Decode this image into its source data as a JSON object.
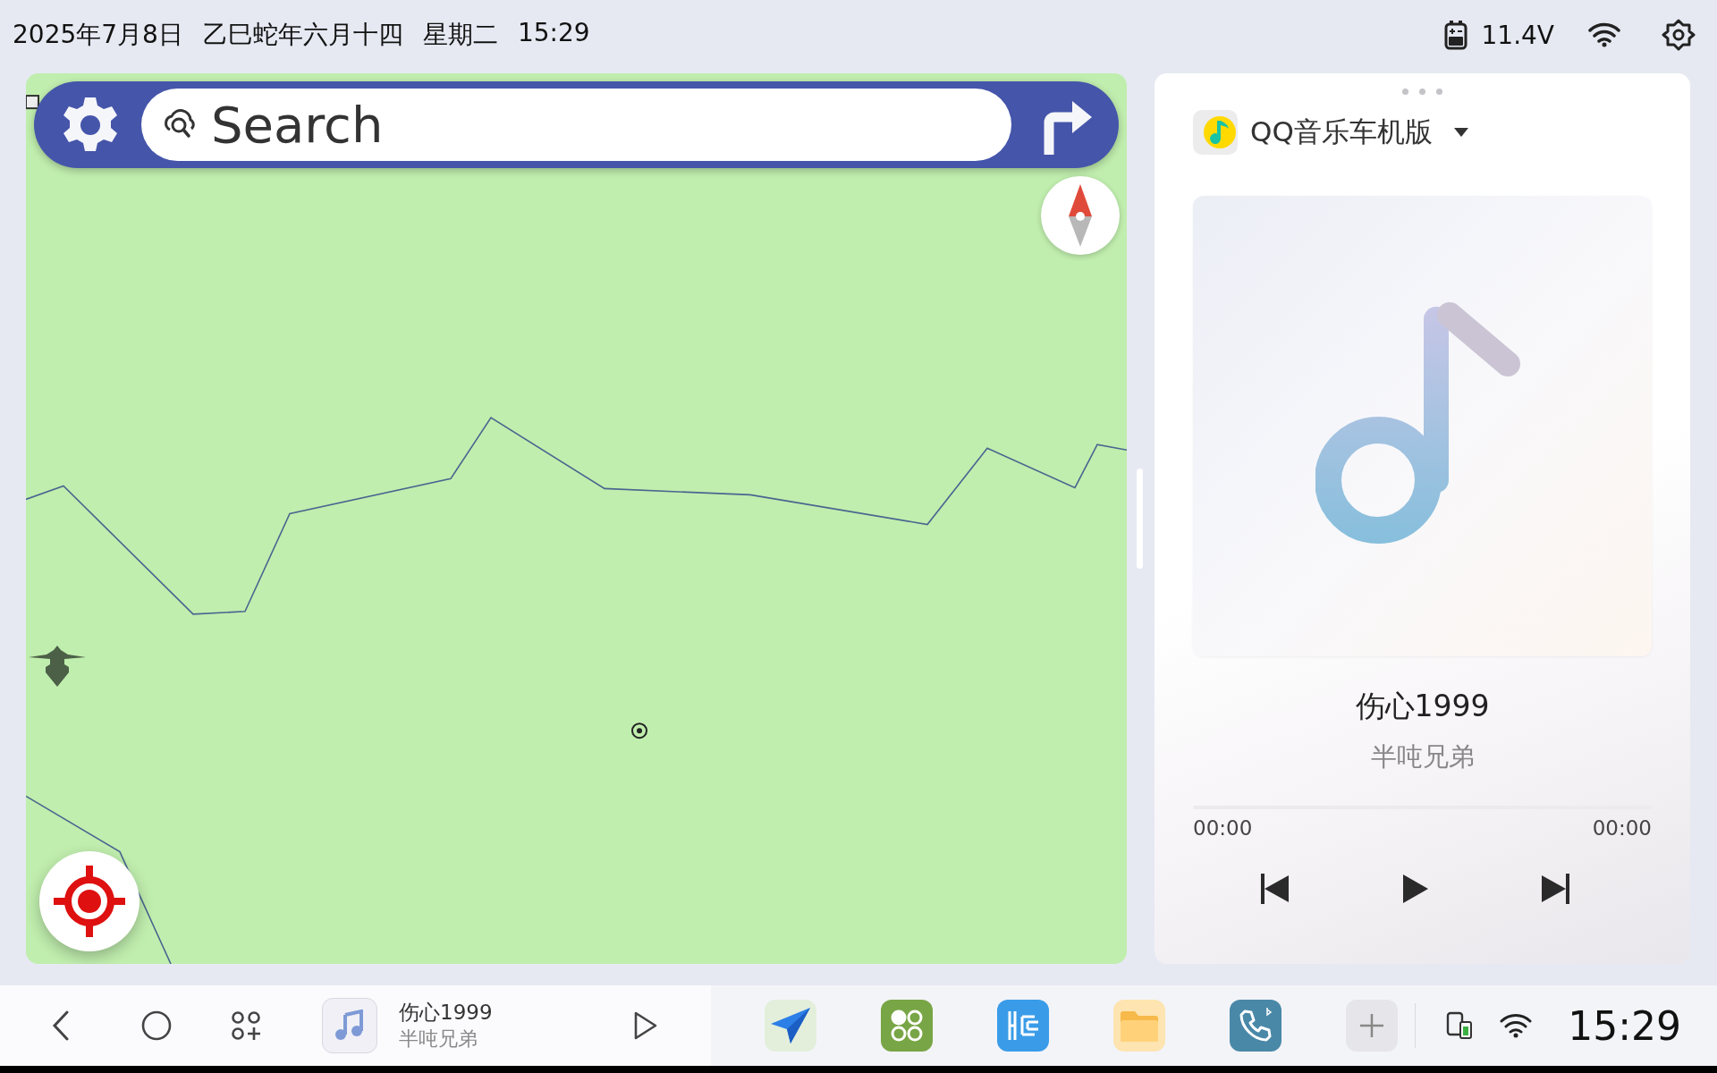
{
  "status_bar": {
    "date": "2025年7月8日",
    "lunar": "乙巳蛇年六月十四",
    "weekday": "星期二",
    "time": "15:29",
    "voltage": "11.4V"
  },
  "map": {
    "kind": "picture",
    "search": {
      "placeholder": "Search"
    }
  },
  "music": {
    "app_name": "QQ音乐车机版",
    "title": "伤心1999",
    "artist": "半吨兄弟",
    "elapsed": "00:00",
    "duration": "00:00",
    "progress": {
      "level": 0
    }
  },
  "taskbar": {
    "now_playing": {
      "title": "伤心1999",
      "artist": "半吨兄弟"
    },
    "time": "15:29"
  }
}
